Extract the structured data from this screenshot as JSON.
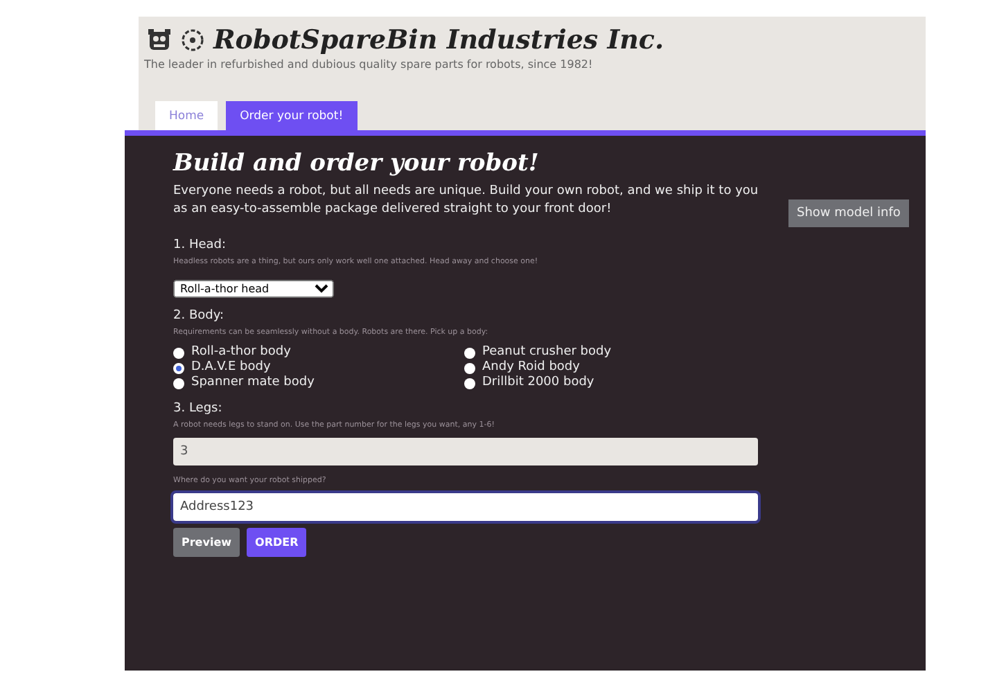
{
  "header": {
    "title": "RobotSpareBin Industries Inc.",
    "tagline": "The leader in refurbished and dubious quality spare parts for robots, since 1982!"
  },
  "tabs": [
    {
      "label": "Home",
      "selected": false
    },
    {
      "label": "Order your robot!",
      "selected": true
    }
  ],
  "form": {
    "title": "Build and order your robot!",
    "intro": "Everyone needs a robot, but all needs are unique. Build your own robot, and we ship it to you as an easy-to-assemble package delivered straight to your front door!",
    "model_button": "Show model info",
    "head": {
      "label": "1. Head:",
      "help": "Headless robots are a thing, but ours only work well one attached. Head away and choose one!",
      "value": "Roll-a-thor head"
    },
    "body": {
      "label": "2. Body:",
      "help": "Requirements can be seamlessly without a body. Robots are there. Pick up a body:",
      "options": [
        {
          "label": "Roll-a-thor body",
          "selected": false
        },
        {
          "label": "Peanut crusher body",
          "selected": false
        },
        {
          "label": "D.A.V.E body",
          "selected": true
        },
        {
          "label": "Andy Roid body",
          "selected": false
        },
        {
          "label": "Spanner mate body",
          "selected": false
        },
        {
          "label": "Drillbit 2000 body",
          "selected": false
        }
      ]
    },
    "legs": {
      "label": "3. Legs:",
      "help": "A robot needs legs to stand on. Use the part number for the legs you want, any 1-6!",
      "value": "3"
    },
    "address": {
      "help": "Where do you want your robot shipped?",
      "value": "Address123"
    },
    "buttons": [
      {
        "label": "Preview",
        "kind": "secondary"
      },
      {
        "label": "ORDER",
        "kind": "primary"
      }
    ]
  }
}
